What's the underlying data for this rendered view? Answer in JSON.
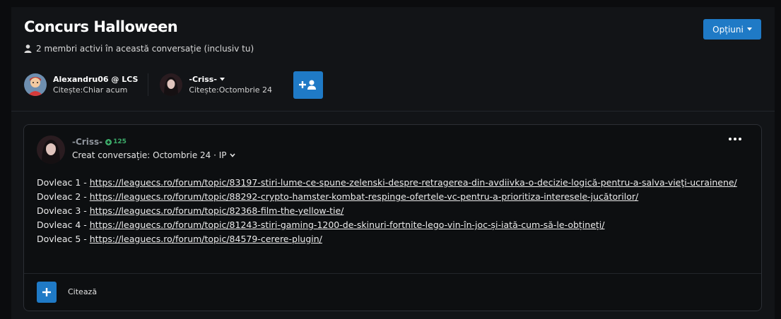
{
  "conversation": {
    "title": "Concurs Halloween",
    "members_info": "2 membri activi în această conversație (inclusiv tu)",
    "options_label": "Opțiuni"
  },
  "participants": [
    {
      "name": "Alexandru06 @ LCS",
      "read_label": "Citește:",
      "read_time": "Chiar acum"
    },
    {
      "name": "-Criss-",
      "read_label": "Citește:",
      "read_time": "Octombrie 24"
    }
  ],
  "post": {
    "author": "-Criss-",
    "reputation": "125",
    "meta": "Creat conversație: Octombrie 24 · IP",
    "lines": [
      {
        "label": "Dovleac 1 - ",
        "url": "https://leaguecs.ro/forum/topic/83197-stiri-lume-ce-spune-zelenski-despre-retragerea-din-avdiivka-o-decizie-logică-pentru-a-salva-vieţi-ucrainene/"
      },
      {
        "label": "Dovleac 2 - ",
        "url": "https://leaguecs.ro/forum/topic/88292-crypto-hamster-kombat-respinge-ofertele-vc-pentru-a-prioritiza-interesele-jucătorilor/"
      },
      {
        "label": "Dovleac 3 - ",
        "url": "https://leaguecs.ro/forum/topic/82368-film-the-yellow-tie/"
      },
      {
        "label": "Dovleac 4 - ",
        "url": "https://leaguecs.ro/forum/topic/81243-stiri-gaming-1200-de-skinuri-fortnite-lego-vin-în-joc-și-iată-cum-să-le-obțineți/"
      },
      {
        "label": "Dovleac 5 - ",
        "url": "https://leaguecs.ro/forum/topic/84579-cerere-plugin/"
      }
    ],
    "quote_label": "Citează"
  },
  "colors": {
    "accent": "#1f7ac6",
    "reputation": "#3dae6b",
    "background": "#0b0c0e",
    "panel": "#121417"
  },
  "icons": [
    "user-icon",
    "caret-down-icon",
    "add-user-icon",
    "plus-circle-icon",
    "more-options-icon",
    "plus-icon"
  ]
}
